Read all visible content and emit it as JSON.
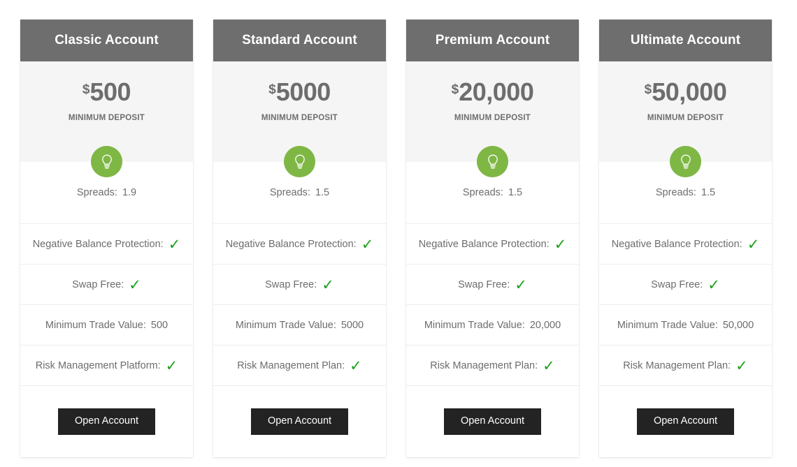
{
  "page": {
    "background_color": "#ffffff",
    "header_color": "#6e6e6e",
    "badge_color": "#7fb745",
    "check_color": "#1aa01a",
    "button_color": "#232323",
    "price_panel_color": "#f5f5f5"
  },
  "common": {
    "currency_symbol": "$",
    "deposit_caption": "MINIMUM DEPOSIT",
    "badge_icon": "lightbulb-icon",
    "check_glyph": "✓",
    "cta_label": "Open Account"
  },
  "plans": [
    {
      "title": "Classic Account",
      "currency": "$",
      "amount": "500",
      "deposit_caption": "MINIMUM DEPOSIT",
      "features": [
        {
          "label": "Spreads:",
          "value": "1.9",
          "type": "value"
        },
        {
          "label": "Negative Balance Protection:",
          "value": "✓",
          "type": "check"
        },
        {
          "label": "Swap Free:",
          "value": "✓",
          "type": "check"
        },
        {
          "label": "Minimum Trade Value:",
          "value": "500",
          "type": "value"
        },
        {
          "label": "Risk Management Platform:",
          "value": "✓",
          "type": "check"
        }
      ],
      "cta_label": "Open Account"
    },
    {
      "title": "Standard Account",
      "currency": "$",
      "amount": "5000",
      "deposit_caption": "MINIMUM DEPOSIT",
      "features": [
        {
          "label": "Spreads:",
          "value": "1.5",
          "type": "value"
        },
        {
          "label": "Negative Balance Protection:",
          "value": "✓",
          "type": "check"
        },
        {
          "label": "Swap Free:",
          "value": "✓",
          "type": "check"
        },
        {
          "label": "Minimum Trade Value:",
          "value": "5000",
          "type": "value"
        },
        {
          "label": "Risk Management Plan:",
          "value": "✓",
          "type": "check"
        }
      ],
      "cta_label": "Open Account"
    },
    {
      "title": "Premium Account",
      "currency": "$",
      "amount": "20,000",
      "deposit_caption": "MINIMUM DEPOSIT",
      "features": [
        {
          "label": "Spreads:",
          "value": "1.5",
          "type": "value"
        },
        {
          "label": "Negative Balance Protection:",
          "value": "✓",
          "type": "check"
        },
        {
          "label": "Swap Free:",
          "value": "✓",
          "type": "check"
        },
        {
          "label": "Minimum Trade Value:",
          "value": "20,000",
          "type": "value"
        },
        {
          "label": "Risk Management Plan:",
          "value": "✓",
          "type": "check"
        }
      ],
      "cta_label": "Open Account"
    },
    {
      "title": "Ultimate Account",
      "currency": "$",
      "amount": "50,000",
      "deposit_caption": "MINIMUM DEPOSIT",
      "features": [
        {
          "label": "Spreads:",
          "value": "1.5",
          "type": "value"
        },
        {
          "label": "Negative Balance Protection:",
          "value": "✓",
          "type": "check"
        },
        {
          "label": "Swap Free:",
          "value": "✓",
          "type": "check"
        },
        {
          "label": "Minimum Trade Value:",
          "value": "50,000",
          "type": "value"
        },
        {
          "label": "Risk Management Plan:",
          "value": "✓",
          "type": "check"
        }
      ],
      "cta_label": "Open Account"
    }
  ]
}
